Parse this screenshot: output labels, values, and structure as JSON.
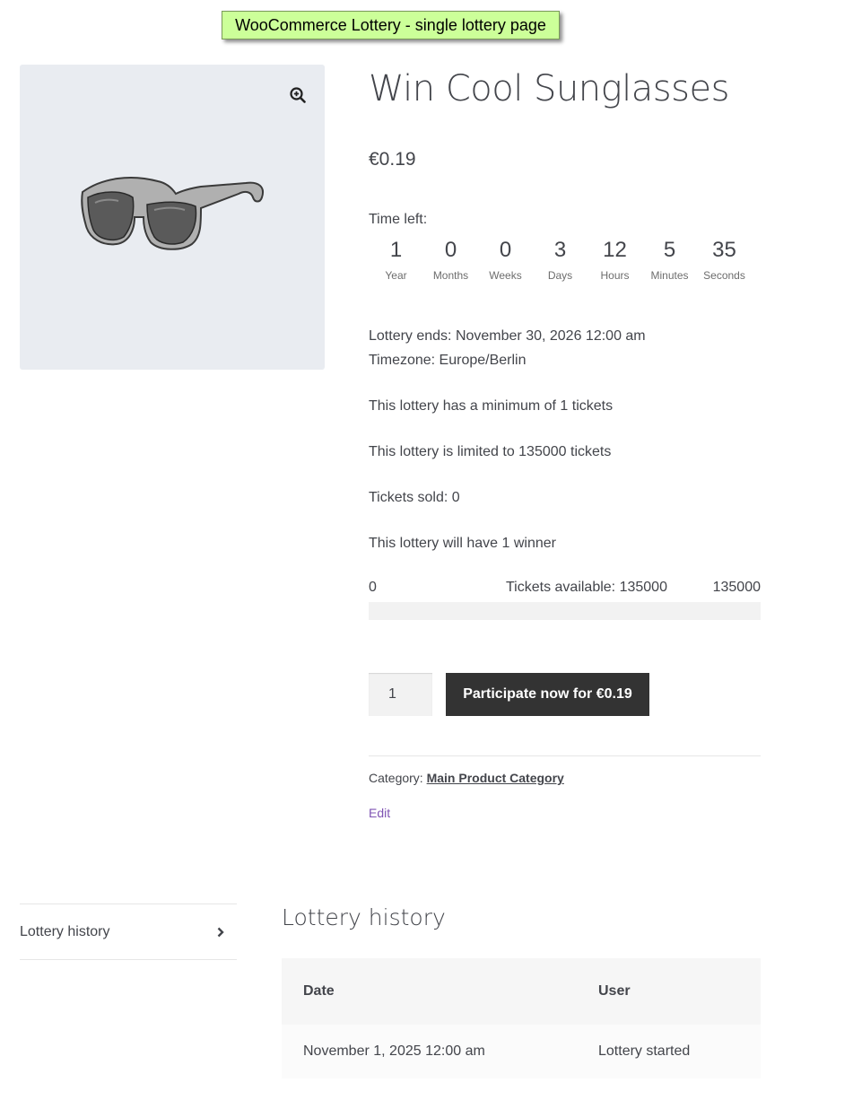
{
  "banner": {
    "text": "WooCommerce Lottery - single lottery page"
  },
  "gallery": {
    "zoom_icon": "zoom-in-icon",
    "image_subject": "sunglasses"
  },
  "product": {
    "title": "Win Cool Sunglasses",
    "price": "€0.19"
  },
  "countdown": {
    "label": "Time left:",
    "units": [
      {
        "value": "1",
        "label": "Year"
      },
      {
        "value": "0",
        "label": "Months"
      },
      {
        "value": "0",
        "label": "Weeks"
      },
      {
        "value": "3",
        "label": "Days"
      },
      {
        "value": "12",
        "label": "Hours"
      },
      {
        "value": "5",
        "label": "Minutes"
      },
      {
        "value": "35",
        "label": "Seconds"
      }
    ]
  },
  "lottery": {
    "ends": "Lottery ends: November 30, 2026 12:00 am",
    "timezone": "Timezone: Europe/Berlin",
    "minimum": "This lottery has a minimum of 1 tickets",
    "limit": "This lottery is limited to 135000 tickets",
    "sold": "Tickets sold: 0",
    "winners": "This lottery will have 1 winner"
  },
  "progress": {
    "min": "0",
    "available": "Tickets available: 135000",
    "max": "135000",
    "fill_fraction": 0,
    "fill_color": "#96588a"
  },
  "cart": {
    "quantity": "1",
    "button_label": "Participate now for €0.19"
  },
  "meta": {
    "category_label": "Category:",
    "category_link": "Main Product Category",
    "edit_label": "Edit"
  },
  "tabs": [
    {
      "label": "Lottery history",
      "icon": "chevron-right-icon"
    }
  ],
  "history": {
    "title": "Lottery history",
    "headers": [
      "Date",
      "User"
    ],
    "rows": [
      [
        "November 1, 2025 12:00 am",
        "Lottery started"
      ]
    ]
  }
}
